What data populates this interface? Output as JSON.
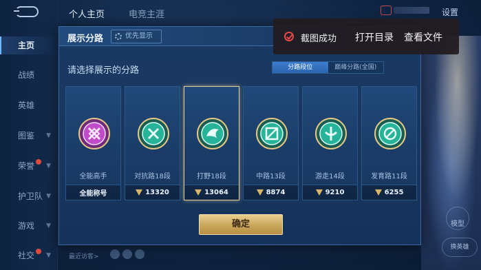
{
  "top_tabs": [
    "个人主页",
    "电竞主涯"
  ],
  "settings_label": "设置",
  "sidebar": {
    "items": [
      {
        "label": "主页",
        "active": true
      },
      {
        "label": "战绩"
      },
      {
        "label": "英雄"
      },
      {
        "label": "图鉴",
        "chevron": true
      },
      {
        "label": "荣誉",
        "chevron": true,
        "badge": true
      },
      {
        "label": "护卫队",
        "chevron": true
      },
      {
        "label": "游戏",
        "chevron": true
      },
      {
        "label": "社交",
        "chevron": true,
        "badge": true
      }
    ]
  },
  "modal": {
    "title": "展示分路",
    "priority_label": "优先显示",
    "subtitle": "请选择展示的分路",
    "toggle": {
      "options": [
        "分路段位",
        "巅峰分路(全国)"
      ],
      "active_index": 0
    },
    "cards": [
      {
        "name": "全能高手",
        "value": "全能称号",
        "emblem_color": "#c04cc9",
        "selected": false,
        "show_icon": false
      },
      {
        "name": "对抗路18段",
        "value": "13320",
        "emblem_color": "#27b39a",
        "selected": false,
        "show_icon": true
      },
      {
        "name": "打野18段",
        "value": "13064",
        "emblem_color": "#27b39a",
        "selected": true,
        "show_icon": true
      },
      {
        "name": "中路13段",
        "value": "8874",
        "emblem_color": "#27b39a",
        "selected": false,
        "show_icon": true
      },
      {
        "name": "游走14段",
        "value": "9210",
        "emblem_color": "#27b39a",
        "selected": false,
        "show_icon": true
      },
      {
        "name": "发育路11段",
        "value": "6255",
        "emblem_color": "#27b39a",
        "selected": false,
        "show_icon": true
      }
    ],
    "confirm_label": "确定"
  },
  "recent_visitors_label": "最近访客>",
  "model_label": "模型",
  "change_hero_label": "换英雄",
  "toast": {
    "message": "截图成功",
    "open_folder": "打开目录",
    "view_file": "查看文件"
  },
  "colors": {
    "accent_gold": "#d9b667",
    "toast_red": "#e84a4a",
    "toggle_active": "#3c7ed0"
  }
}
